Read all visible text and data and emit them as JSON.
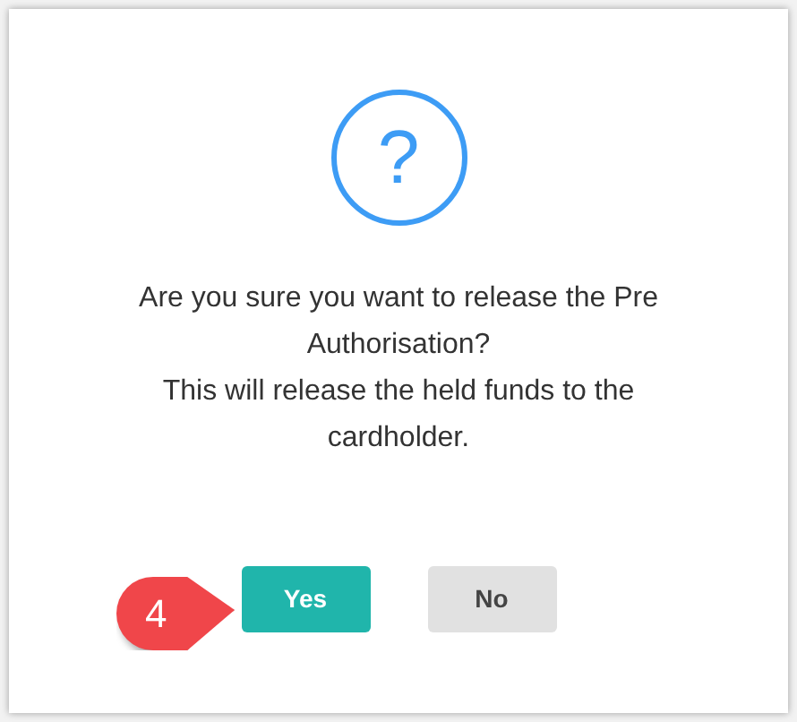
{
  "dialog": {
    "icon_glyph": "?",
    "messages": [
      "Are you sure you want to release the Pre Authorisation?",
      "This will release the held funds to the cardholder."
    ],
    "buttons": [
      {
        "label": "Yes",
        "kind": "primary"
      },
      {
        "label": "No",
        "kind": "secondary"
      }
    ],
    "callout": {
      "label": "4"
    }
  }
}
